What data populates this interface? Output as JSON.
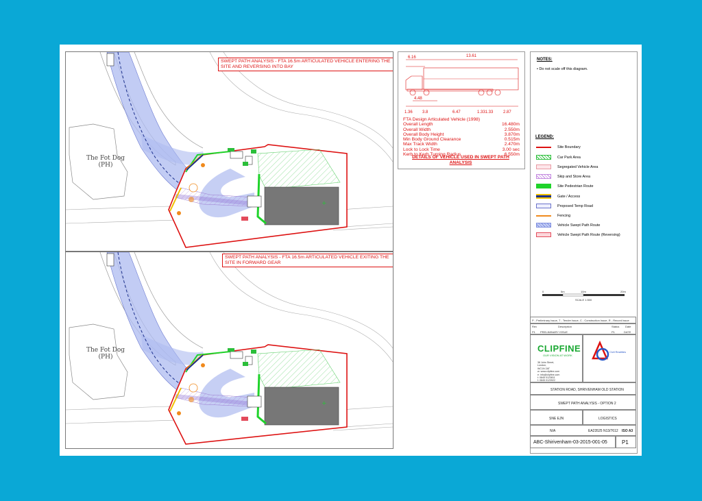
{
  "plan1": {
    "title": "SWEPT PATH ANALYSIS - FTA 16.5m ARTICULATED VEHICLE ENTERING THE SITE AND REVERSING INTO BAY",
    "pub_name": "The Fot Dog",
    "pub_suffix": "(PH)"
  },
  "plan2": {
    "title": "SWEPT PATH ANALYSIS - FTA 16.5m ARTICULATED VEHICLE EXITING THE SITE IN FORWARD GEAR",
    "pub_name": "The Fot Dog",
    "pub_suffix": "(PH)"
  },
  "vehicle": {
    "dims": {
      "overall": "13.61",
      "front": "6.16",
      "cab": "4.48",
      "d1": "1.36",
      "d2": "3.8",
      "d3": "6.47",
      "d4": "1.331.33",
      "d5": "2.87"
    },
    "name": "FTA Design Articulated Vehicle (1998)",
    "specs": [
      {
        "label": "Overall Length",
        "value": "16.480m"
      },
      {
        "label": "Overall Width",
        "value": "2.550m"
      },
      {
        "label": "Overall Body Height",
        "value": "3.870m"
      },
      {
        "label": "Min Body Ground Clearance",
        "value": "0.515m"
      },
      {
        "label": "Max Track Width",
        "value": "2.470m"
      },
      {
        "label": "Lock to Lock Time",
        "value": "3.00 sec"
      },
      {
        "label": "Kerb to Kerb Turning Radius",
        "value": "6.550m"
      }
    ],
    "caption": "DETAILS OF VEHICLE USED IN SWEPT PATH ANALYSIS"
  },
  "notes": {
    "title": "NOTES:",
    "text": "• Do not scale off this diagram."
  },
  "legend": {
    "title": "LEGEND:",
    "items": [
      {
        "label": "Site Boundary",
        "color": "#d11"
      },
      {
        "label": "Car Park Area",
        "color": "#2bbf3a"
      },
      {
        "label": "Segregated Vehicle Area",
        "color": "#e89aa4"
      },
      {
        "label": "Skip and Store Area",
        "color": "#c48ae0"
      },
      {
        "label": "Site Pedestrian Route",
        "color": "#1fd32a"
      },
      {
        "label": "Gate / Access",
        "color": "#1b2f8c"
      },
      {
        "label": "Proposed Temp Road",
        "color": "#6a72c9"
      },
      {
        "label": "Fencing",
        "color": "#f08a1c"
      },
      {
        "label": "Vehicle Swept Path Route",
        "color": "#7f8fe0"
      },
      {
        "label": "Vehicle Swept Path Route (Reversing)",
        "color": "#e34b5b"
      }
    ]
  },
  "scale": {
    "ticks": [
      "0",
      "5m",
      "10m",
      "20m"
    ],
    "label": "SCALE 1:500"
  },
  "titleblock": {
    "revision_key": "P - Preliminary Issue, T - Tender Issue, C - Construction Issue, R - Record Issue",
    "rev_headers": [
      "Rev",
      "Description",
      "Status",
      "Date"
    ],
    "rev_row": [
      "P1",
      "PRELIMINARY ISSUE",
      "P1",
      "DATE"
    ],
    "company": "CLIPFINE",
    "company_tag": "OUR VISION AT WORK",
    "address_lines": [
      "38 John Street,",
      "London,",
      "WC1N 2AT",
      "w: www.clipfine.com",
      "e: info@clipfine.com",
      "t: 0845 0123811",
      "f: 0845 0123922"
    ],
    "client_logo_text": "Civil Realities",
    "project": "STATION ROAD, SHRIVENHAM OLD STATION",
    "drawing_title": "SWEPT PATH ANALYSIS - OPTION 2",
    "drawn": "SNE EJN",
    "discipline": "LOGISTICS",
    "scale_text": "N/A",
    "ref": "EA23525 N13/7612",
    "size": "ISO A3",
    "drawing_number": "ABC-Shirivenham-03-2015-001-05",
    "revision": "P1"
  }
}
